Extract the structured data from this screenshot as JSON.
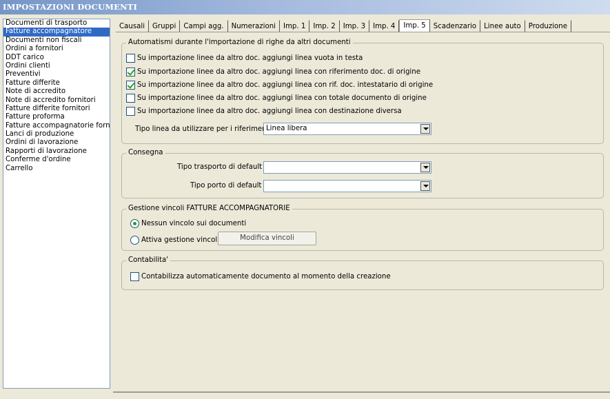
{
  "window": {
    "title": "IMPOSTAZIONI DOCUMENTI"
  },
  "documents": [
    "Documenti di trasporto",
    "Fatture accompagnatore",
    "Documenti non fiscali",
    "Ordini a fornitori",
    "DDT carico",
    "Ordini clienti",
    "Preventivi",
    "Fatture differite",
    "Note di accredito",
    "Note di accredito fornitori",
    "Fatture differite fornitori",
    "Fatture proforma",
    "Fatture accompagnatorie fornito",
    "Lanci di produzione",
    "Ordini di lavorazione",
    "Rapporti di lavorazione",
    "Conferme d'ordine",
    "Carrello"
  ],
  "selected_document": "Fatture accompagnatore",
  "tabs": [
    "Causali",
    "Gruppi",
    "Campi agg.",
    "Numerazioni",
    "Imp. 1",
    "Imp. 2",
    "Imp. 3",
    "Imp. 4",
    "Imp. 5",
    "Scadenzario",
    "Linee auto",
    "Produzione"
  ],
  "active_tab": "Imp. 5",
  "automatismi": {
    "legend": "Automatismi durante l'importazione di righe da altri documenti",
    "options": [
      {
        "label": "Su importazione linee da altro doc. aggiungi linea vuota in testa",
        "checked": false
      },
      {
        "label": "Su importazione linee da altro doc. aggiungi linea con riferimento doc. di origine",
        "checked": true
      },
      {
        "label": "Su importazione linee da altro doc. aggiungi linea con rif. doc. intestatario di origine",
        "checked": true
      },
      {
        "label": "Su importazione linee da altro doc. aggiungi linea con totale documento di origine",
        "checked": false
      },
      {
        "label": "Su importazione linee da altro doc. aggiungi linea con destinazione diversa",
        "checked": false
      }
    ],
    "tipo_linea_label": "Tipo linea da utilizzare per i riferimenti :",
    "tipo_linea_value": "Linea libera"
  },
  "consegna": {
    "legend": "Consegna",
    "trasporto_label": "Tipo trasporto di default :",
    "trasporto_value": "",
    "porto_label": "Tipo porto di default :",
    "porto_value": ""
  },
  "vincoli": {
    "legend": "Gestione vincoli FATTURE ACCOMPAGNATORIE",
    "option_none": "Nessun vincolo sui documenti",
    "option_active": "Attiva gestione vincoli",
    "selected": "none",
    "modify_button": "Modifica vincoli"
  },
  "contabilita": {
    "legend": "Contabilita'",
    "option": "Contabilizza automaticamente documento al momento della creazione",
    "checked": false
  },
  "colors": {
    "selection": "#316ac5",
    "window_bg": "#ece9d8",
    "check": "#21a121"
  }
}
